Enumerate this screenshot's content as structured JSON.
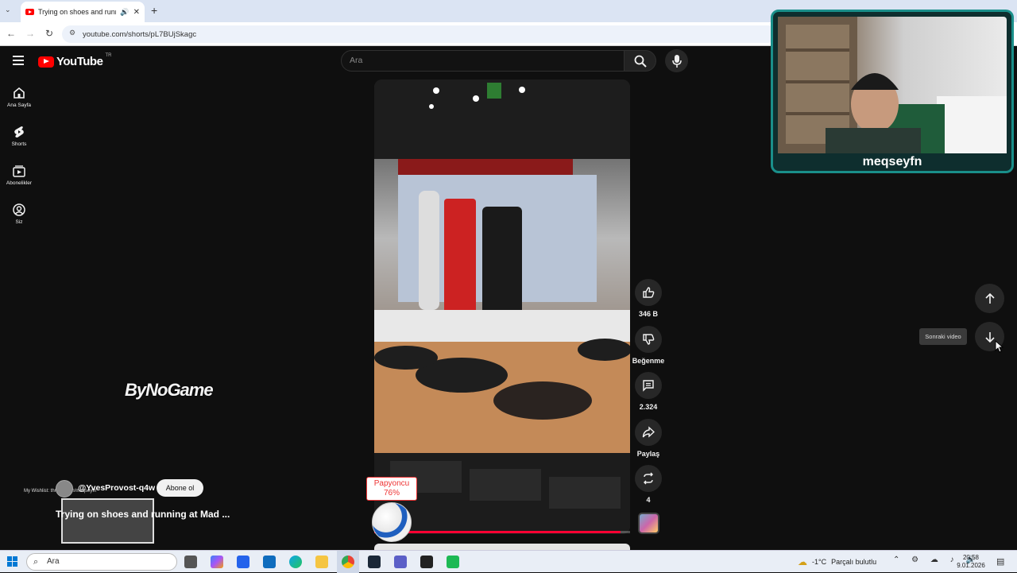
{
  "browser": {
    "tab_title": "Trying on shoes and running",
    "url": "youtube.com/shorts/pL7BUjSkagc"
  },
  "header": {
    "logo_text": "YouTube",
    "country_code": "TR",
    "search_placeholder": "Ara"
  },
  "sidebar": {
    "items": [
      {
        "label": "Ana Sayfa",
        "icon": "home-icon"
      },
      {
        "label": "Shorts",
        "icon": "shorts-icon"
      },
      {
        "label": "Abonelikler",
        "icon": "subscriptions-icon"
      },
      {
        "label": "Siz",
        "icon": "user-icon"
      }
    ]
  },
  "actions": {
    "like_count": "346 B",
    "dislike_label": "Beğenme",
    "comment_count": "2.324",
    "share_label": "Paylaş",
    "remix_count": "4"
  },
  "navigation": {
    "next_tooltip": "Sonraki video"
  },
  "overlay": {
    "streamer_name": "meqseyfn",
    "sponsor_logo": "ByNoGame",
    "channel_handle": "@YvesProvost-q4w",
    "subscribe_label": "Abone ol",
    "wishlist_text": "My Wishlist: throne.com/meqseyfn",
    "short_title": "Trying on shoes and running at Mad ...",
    "stake_name": "Papyoncu",
    "stake_pct": "76%"
  },
  "taskbar": {
    "search_placeholder": "Ara",
    "weather": "-1°C",
    "weather_desc": "Parçalı bulutlu",
    "time": "20:58",
    "date": "9.01.2026"
  },
  "colors": {
    "accent": "#ff0000",
    "background": "#0f0f0f",
    "webcam_frame": "#1a8f8a"
  }
}
